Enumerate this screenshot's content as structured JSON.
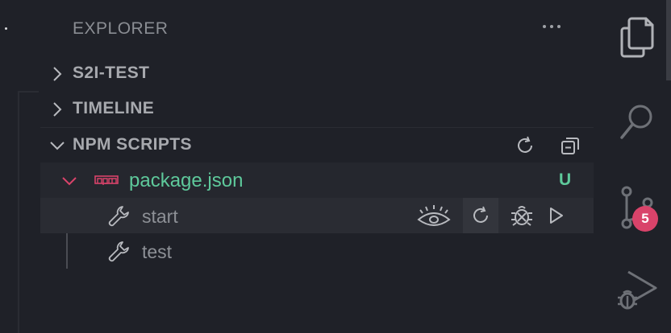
{
  "explorer": {
    "title": "EXPLORER",
    "more_actions": "···"
  },
  "sections": {
    "s2i": {
      "label": "S2I-TEST",
      "expanded": false
    },
    "timeline": {
      "label": "TIMELINE",
      "expanded": false
    },
    "npm": {
      "label": "NPM SCRIPTS",
      "expanded": true
    }
  },
  "npm_scripts": {
    "package": {
      "name": "package.json",
      "status": "U"
    },
    "scripts": [
      {
        "name": "start"
      },
      {
        "name": "test"
      }
    ]
  },
  "activity_bar": {
    "items": [
      "files-icon",
      "search-icon",
      "source-control-icon",
      "run-debug-icon"
    ],
    "source_control_badge": "5"
  },
  "colors": {
    "background": "#1f2128",
    "accent_green": "#5ec99b",
    "chevron_red": "#d9436a",
    "badge": "#d9436a"
  }
}
